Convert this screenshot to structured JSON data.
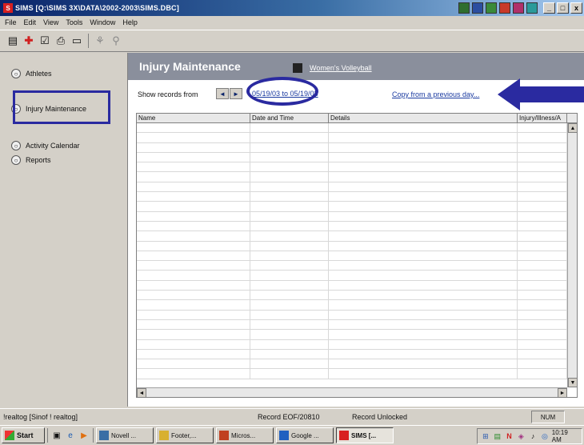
{
  "window": {
    "title": "SIMS [Q:\\SIMS 3X\\DATA\\2002-2003\\SIMS.DBC]",
    "controls": [
      "_",
      "□",
      "x"
    ]
  },
  "menu": [
    "File",
    "Edit",
    "View",
    "Tools",
    "Window",
    "Help"
  ],
  "toolbar": {
    "icons": [
      "properties-icon",
      "add-icon",
      "checkbox-icon",
      "print-icon",
      "clipboard-icon",
      "sep",
      "help-icon",
      "find-icon"
    ]
  },
  "sidebar": {
    "items": [
      {
        "label": "Athletes",
        "faded": false
      },
      {
        "label": "Injury Maintenance",
        "faded": false
      },
      {
        "label": "Activity Calendar",
        "faded": false
      },
      {
        "label": "Reports",
        "faded": false
      }
    ]
  },
  "header": {
    "title": "Injury Maintenance",
    "group": "Women's Volleyball"
  },
  "records": {
    "label": "Show records from",
    "nav_prev": "◄",
    "nav_next": "►",
    "date_range": "05/19/03 to 05/19/03",
    "copy_link": "Copy from a previous day..."
  },
  "grid": {
    "columns": [
      "Name",
      "Date and Time",
      "Details",
      "Injury/Illness/A"
    ],
    "row_count": 26
  },
  "statusbar": {
    "left": "!realtog [Sinof ! realtog]",
    "record": "Record EOF/20810",
    "lock": "Record Unlocked",
    "num": "NUM"
  },
  "taskbar": {
    "start": "Start",
    "tasks": [
      "Novell ...",
      "Footer,...",
      "Micros...",
      "Google ...",
      "SIMS [..."
    ],
    "clock": "10:19 AM"
  },
  "colors": {
    "annotation": "#2a2aa0",
    "header_bg": "#8a8f9c",
    "link": "#1a3aa0"
  }
}
